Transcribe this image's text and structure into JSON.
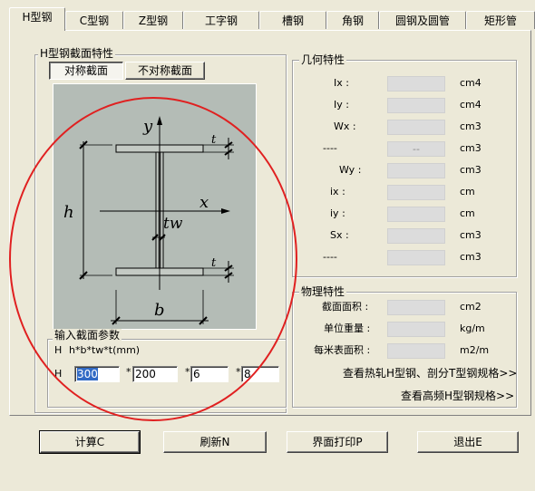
{
  "tabs": [
    "H型钢",
    "C型钢",
    "Z型钢",
    "工字钢",
    "槽钢",
    "角钢",
    "圆钢及圆管",
    "矩形管"
  ],
  "section": {
    "title": "H型钢截面特性",
    "sym_button": "对称截面",
    "asym_button": "不对称截面"
  },
  "diagram": {
    "y_label": "y",
    "x_label": "x",
    "h_label": "h",
    "tw_label": "tw",
    "b_label": "b",
    "t_label": "t",
    "bg_color": "#b4bcb6"
  },
  "input": {
    "title": "输入截面参数",
    "formula_prefix": "H",
    "formula": "h*b*tw*t(mm)",
    "row_label": "H",
    "sep": "*",
    "h_value": "300",
    "b_value": "200",
    "tw_value": "6",
    "t_value": "8"
  },
  "geometry": {
    "title": "几何特性",
    "rows": [
      {
        "label": "Ix :",
        "value": "",
        "unit": "cm4"
      },
      {
        "label": "Iy :",
        "value": "",
        "unit": "cm4"
      },
      {
        "label": "Wx :",
        "value": "",
        "unit": "cm3"
      },
      {
        "label": "----",
        "value": "--",
        "unit": "cm3"
      },
      {
        "label": "Wy :",
        "value": "",
        "unit": "cm3"
      },
      {
        "label": "ix :",
        "value": "",
        "unit": "cm"
      },
      {
        "label": "iy :",
        "value": "",
        "unit": "cm"
      },
      {
        "label": "Sx :",
        "value": "",
        "unit": "cm3"
      },
      {
        "label": "----",
        "value": "",
        "unit": "cm3"
      }
    ]
  },
  "physical": {
    "title": "物理特性",
    "rows": [
      {
        "label": "截面面积 :",
        "value": "",
        "unit": "cm2"
      },
      {
        "label": "单位重量 :",
        "value": "",
        "unit": "kg/m"
      },
      {
        "label": "每米表面积 :",
        "value": "",
        "unit": "m2/m"
      }
    ],
    "link1": "查看热轧H型钢、剖分T型钢规格>>",
    "link2": "查看高频H型钢规格>>"
  },
  "buttons": {
    "calc": "计算C",
    "refresh": "刷新N",
    "print": "界面打印P",
    "exit": "退出E"
  },
  "annotation_color": "#e02020"
}
